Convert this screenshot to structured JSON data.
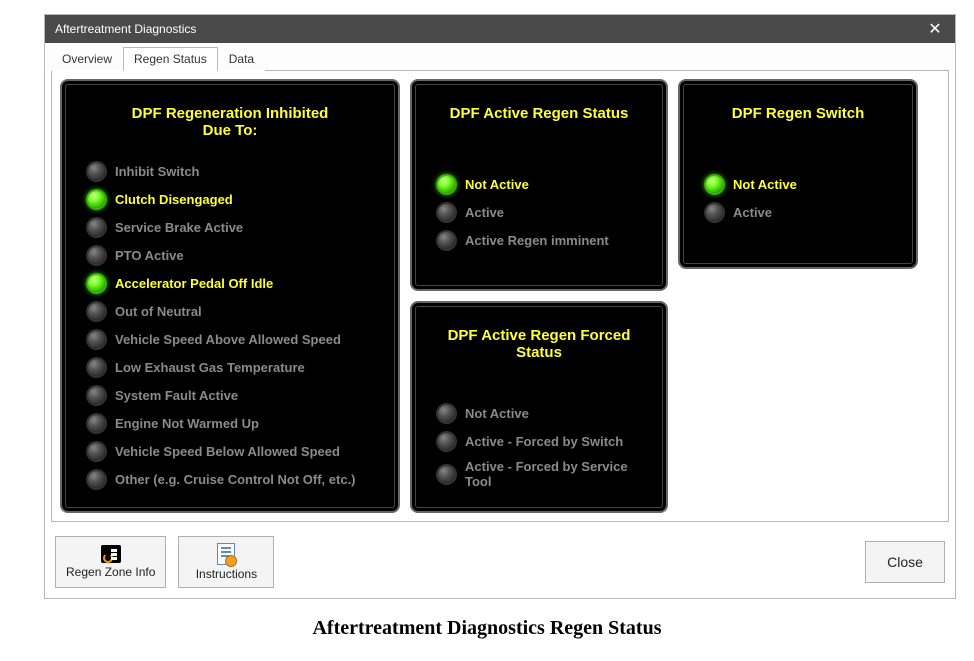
{
  "window": {
    "title": "Aftertreatment Diagnostics"
  },
  "tabs": {
    "overview": "Overview",
    "regen_status": "Regen Status",
    "data": "Data"
  },
  "panel_inhibit": {
    "title_l1": "DPF Regeneration Inhibited",
    "title_l2": "Due To:",
    "items": [
      {
        "label": "Inhibit Switch",
        "on": false
      },
      {
        "label": "Clutch Disengaged",
        "on": true
      },
      {
        "label": "Service Brake Active",
        "on": false
      },
      {
        "label": "PTO Active",
        "on": false
      },
      {
        "label": "Accelerator Pedal Off Idle",
        "on": true
      },
      {
        "label": "Out of Neutral",
        "on": false
      },
      {
        "label": "Vehicle Speed Above Allowed Speed",
        "on": false
      },
      {
        "label": "Low Exhaust Gas Temperature",
        "on": false
      },
      {
        "label": "System Fault Active",
        "on": false
      },
      {
        "label": "Engine Not Warmed Up",
        "on": false
      },
      {
        "label": "Vehicle Speed Below Allowed Speed",
        "on": false
      },
      {
        "label": "Other (e.g. Cruise Control Not Off, etc.)",
        "on": false
      }
    ]
  },
  "panel_active": {
    "title": "DPF Active Regen Status",
    "items": [
      {
        "label": "Not Active",
        "on": true
      },
      {
        "label": "Active",
        "on": false
      },
      {
        "label": "Active Regen imminent",
        "on": false
      }
    ]
  },
  "panel_forced": {
    "title_l1": "DPF Active Regen Forced",
    "title_l2": "Status",
    "items": [
      {
        "label": "Not Active",
        "on": false
      },
      {
        "label": "Active - Forced by Switch",
        "on": false
      },
      {
        "label": "Active - Forced by Service Tool",
        "on": false
      }
    ]
  },
  "panel_switch": {
    "title": "DPF Regen Switch",
    "items": [
      {
        "label": "Not Active",
        "on": true
      },
      {
        "label": "Active",
        "on": false
      }
    ]
  },
  "buttons": {
    "regen_zone": "Regen Zone Info",
    "instructions": "Instructions",
    "close": "Close"
  },
  "caption": "Aftertreatment Diagnostics Regen Status"
}
